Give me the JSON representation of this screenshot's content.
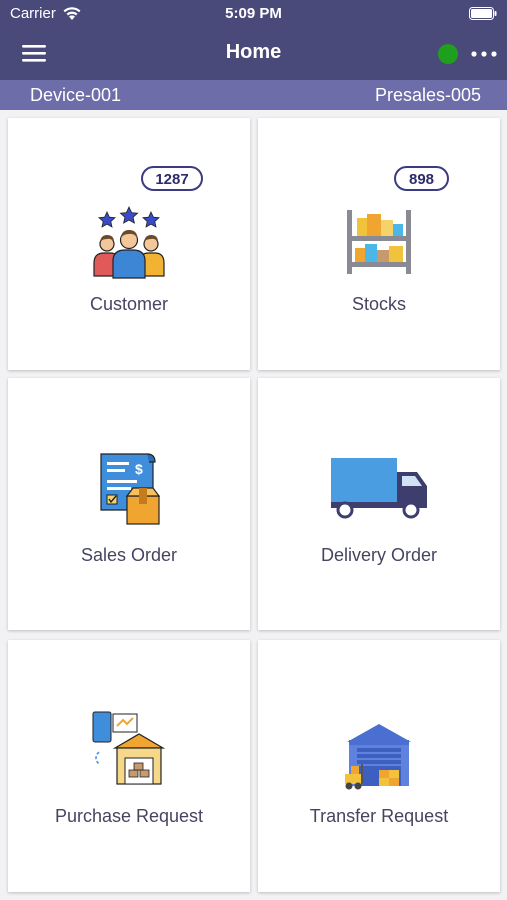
{
  "status_bar": {
    "carrier": "Carrier",
    "time": "5:09 PM"
  },
  "nav": {
    "title": "Home",
    "online_color": "#1ea01e"
  },
  "info_bar": {
    "device": "Device-001",
    "presales": "Presales-005"
  },
  "tiles": [
    {
      "label": "Customer",
      "badge": "1287",
      "icon": "customer-group-icon"
    },
    {
      "label": "Stocks",
      "badge": "898",
      "icon": "stock-shelf-icon"
    },
    {
      "label": "Sales Order",
      "icon": "sales-order-invoice-icon"
    },
    {
      "label": "Delivery Order",
      "icon": "delivery-truck-icon"
    },
    {
      "label": "Purchase Request",
      "icon": "purchase-warehouse-icon"
    },
    {
      "label": "Transfer Request",
      "icon": "transfer-warehouse-icon"
    }
  ],
  "colors": {
    "header": "#4a4a7a",
    "subheader": "#6d6daa",
    "badge_border": "#3b3b85"
  }
}
